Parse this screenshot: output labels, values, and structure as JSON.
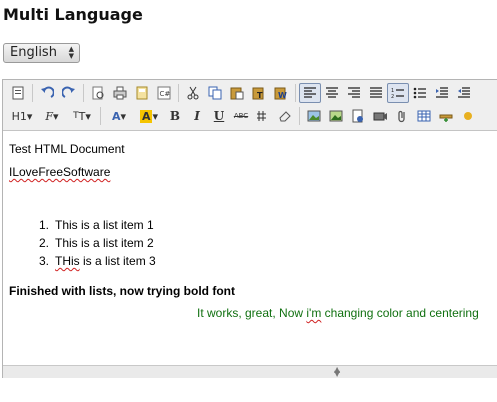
{
  "heading": "Multi Language",
  "language_select": {
    "value": "English"
  },
  "toolbar": {
    "row1": [
      "source-icon",
      "undo-icon",
      "redo-icon",
      "preview-icon",
      "print-icon",
      "template-icon",
      "code-icon",
      "cut-icon",
      "copy-icon",
      "paste-icon",
      "paste-text-icon",
      "paste-word-icon",
      "align-left-icon",
      "align-center-icon",
      "align-right-icon",
      "align-justify-icon",
      "ordered-list-icon",
      "unordered-list-icon",
      "indent-icon",
      "outdent-icon"
    ],
    "row2_labels": {
      "heading": "H1",
      "font": "F",
      "size": "T",
      "bold": "B",
      "italic": "I",
      "underline": "U",
      "strike": "ABC"
    }
  },
  "content": {
    "title": "Test HTML Document",
    "misspelled_word": "ILoveFreeSoftware",
    "list_items": [
      {
        "num": "1.",
        "text": "This is a list item 1"
      },
      {
        "num": "2.",
        "text": "This is a list item 2"
      },
      {
        "num": "3.",
        "text_prefix": "",
        "misspelled": "THis",
        "text_suffix": " is a list item 3"
      }
    ],
    "bold_line": "Finished with lists, now trying bold font",
    "green_line_prefix": "It works, great, Now ",
    "green_line_misspelled": "i'm",
    "green_line_suffix": " changing color and centering",
    "green_color": "#107010"
  }
}
